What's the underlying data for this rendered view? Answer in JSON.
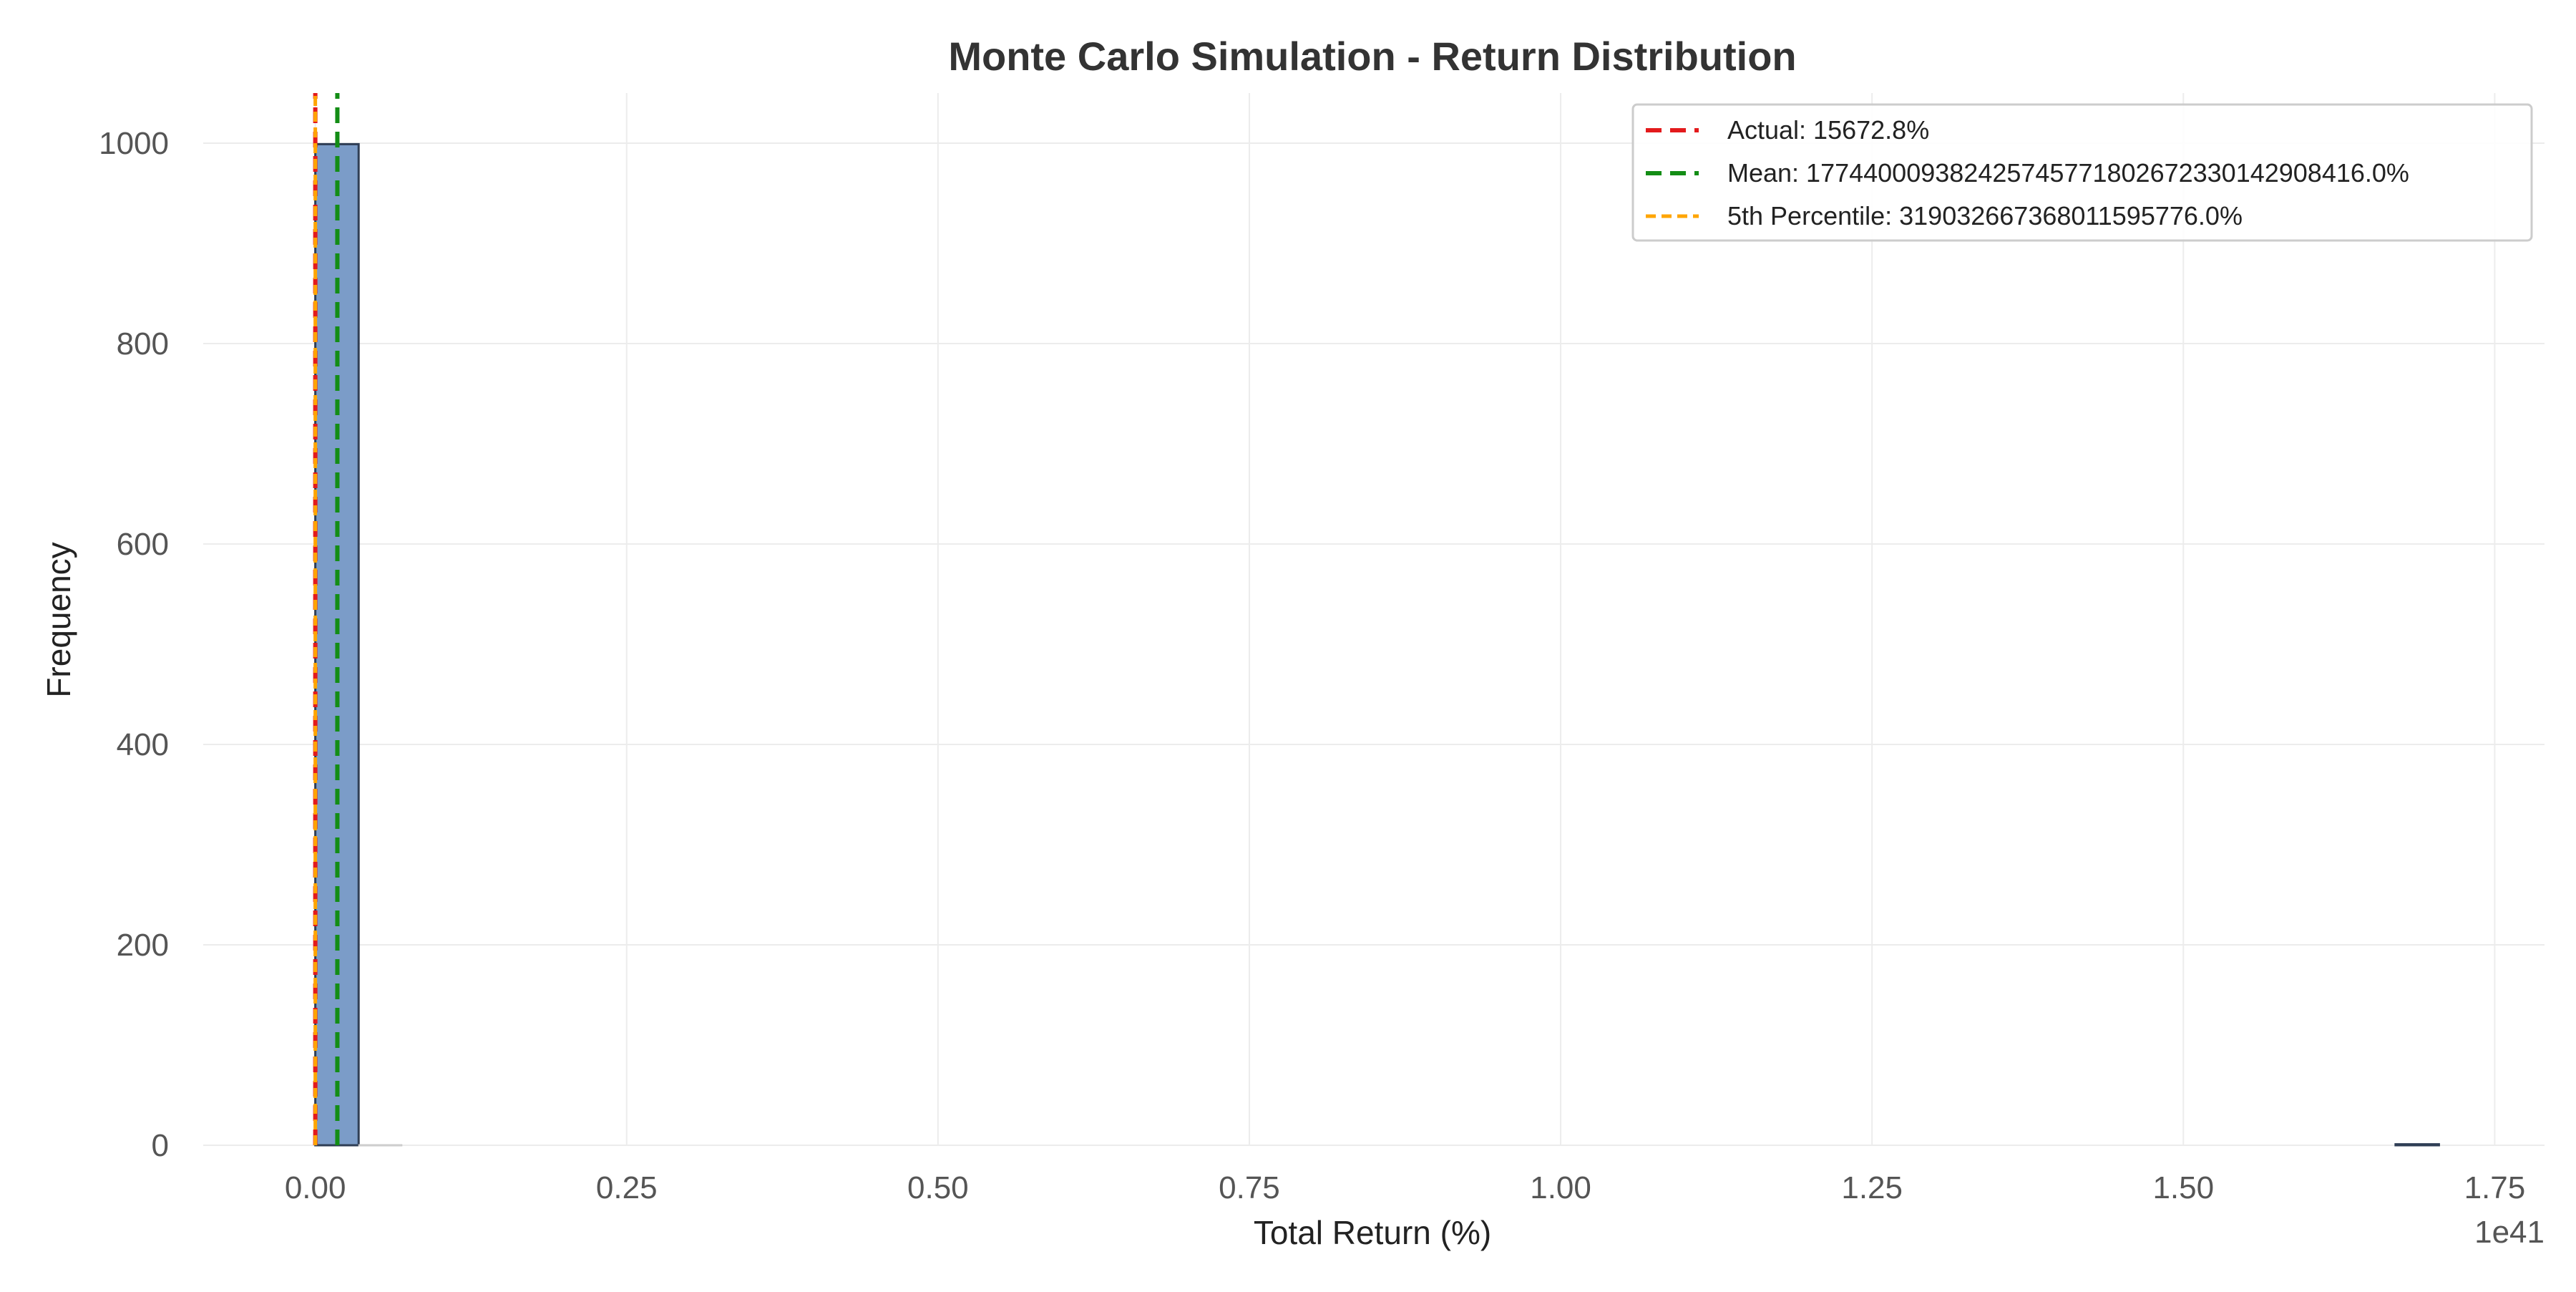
{
  "chart_data": {
    "type": "bar",
    "title": "Monte Carlo Simulation - Return Distribution",
    "xlabel": "Total Return (%)",
    "ylabel": "Frequency",
    "x_offset_label": "1e41",
    "xlim": [
      -0.09,
      1.79
    ],
    "ylim": [
      0,
      1050
    ],
    "x_ticks": [
      {
        "value": 0.0,
        "label": "0.00"
      },
      {
        "value": 0.25,
        "label": "0.25"
      },
      {
        "value": 0.5,
        "label": "0.50"
      },
      {
        "value": 0.75,
        "label": "0.75"
      },
      {
        "value": 1.0,
        "label": "1.00"
      },
      {
        "value": 1.25,
        "label": "1.25"
      },
      {
        "value": 1.5,
        "label": "1.50"
      },
      {
        "value": 1.75,
        "label": "1.75"
      }
    ],
    "y_ticks": [
      {
        "value": 0,
        "label": "0"
      },
      {
        "value": 200,
        "label": "200"
      },
      {
        "value": 400,
        "label": "400"
      },
      {
        "value": 600,
        "label": "600"
      },
      {
        "value": 800,
        "label": "800"
      },
      {
        "value": 1000,
        "label": "1000"
      }
    ],
    "grid": true,
    "legend_position": "top-right",
    "bins": [
      {
        "start": 0.0,
        "end": 0.0348,
        "count": 999
      },
      {
        "start": 0.0348,
        "end": 0.0696,
        "count": 0
      },
      {
        "start": 1.6704,
        "end": 1.7052,
        "count": 1
      }
    ],
    "bar_color": "#7b9cc8",
    "bar_edge_color": "#2f3e55",
    "vlines": [
      {
        "name": "Actual: 15672.8%",
        "x": 0.0,
        "color": "#e31a1c",
        "style": "dashed"
      },
      {
        "name": "Mean: 177440009382425745771802672330142908416.0%",
        "x": 0.0177,
        "color": "#138d15",
        "style": "dashed"
      },
      {
        "name": "5th Percentile: 319032667368011595776.0%",
        "x": 0.0,
        "color": "#ffa500",
        "style": "dashed-fine"
      }
    ]
  }
}
